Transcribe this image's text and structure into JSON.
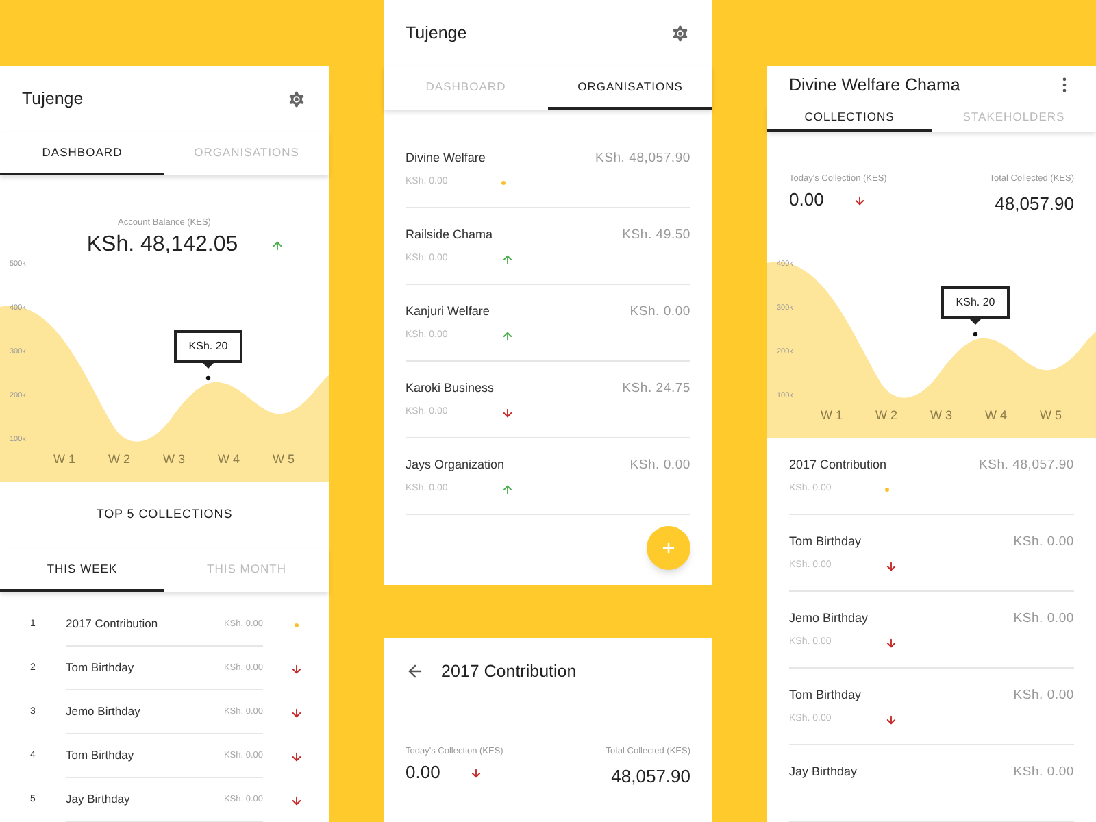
{
  "dashboard_screen": {
    "app_title": "Tujenge",
    "tabs": [
      {
        "label": "DASHBOARD",
        "selected": true
      },
      {
        "label": "ORGANISATIONS",
        "selected": false
      }
    ],
    "balance": {
      "label": "Account Balance (KES)",
      "amount": "KSh. 48,142.05",
      "kind": "up"
    },
    "chart": {
      "y_axis_labels": [
        "500k",
        "400k",
        "300k",
        "200k",
        "100k"
      ],
      "x_axis_labels": [
        "W 1",
        "W 2",
        "W 3",
        "W 4",
        "W 5"
      ],
      "tooltip": "KSh. 20"
    },
    "section_title": "TOP 5 COLLECTIONS",
    "period_tabs": [
      {
        "label": "THIS WEEK",
        "selected": true
      },
      {
        "label": "THIS MONTH",
        "selected": false
      }
    ],
    "collections": [
      {
        "rank": "1",
        "name": "2017 Contribution",
        "amount": "KSh. 0.00",
        "kind": "flat"
      },
      {
        "rank": "2",
        "name": "Tom Birthday",
        "amount": "KSh. 0.00",
        "kind": "down"
      },
      {
        "rank": "3",
        "name": "Jemo Birthday",
        "amount": "KSh. 0.00",
        "kind": "down"
      },
      {
        "rank": "4",
        "name": "Tom Birthday",
        "amount": "KSh. 0.00",
        "kind": "down"
      },
      {
        "rank": "5",
        "name": "Jay Birthday",
        "amount": "KSh. 0.00",
        "kind": "down"
      }
    ]
  },
  "organisations_screen": {
    "app_title": "Tujenge",
    "tabs": [
      {
        "label": "DASHBOARD",
        "selected": false
      },
      {
        "label": "ORGANISATIONS",
        "selected": true
      }
    ],
    "organisations": [
      {
        "name": "Divine Welfare",
        "total": "KSh. 48,057.90",
        "today": "KSh. 0.00",
        "kind": "flat"
      },
      {
        "name": "Railside Chama",
        "total": "KSh. 49.50",
        "today": "KSh. 0.00",
        "kind": "up"
      },
      {
        "name": "Kanjuri Welfare",
        "total": "KSh. 0.00",
        "today": "KSh. 0.00",
        "kind": "up"
      },
      {
        "name": "Karoki Business",
        "total": "KSh. 24.75",
        "today": "KSh. 0.00",
        "kind": "down"
      },
      {
        "name": "Jays Organization",
        "total": "KSh. 0.00",
        "today": "KSh. 0.00",
        "kind": "up"
      }
    ]
  },
  "contribution_screen": {
    "title": "2017 Contribution",
    "todays_collection": {
      "label": "Today's Collection (KES)",
      "value": "0.00",
      "kind": "down"
    },
    "total_collected": {
      "label": "Total Collected (KES)",
      "value": "48,057.90"
    }
  },
  "chama_screen": {
    "title": "Divine Welfare Chama",
    "tabs": [
      {
        "label": "COLLECTIONS",
        "selected": true
      },
      {
        "label": "STAKEHOLDERS",
        "selected": false
      }
    ],
    "todays_collection": {
      "label": "Today's Collection (KES)",
      "value": "0.00",
      "kind": "down"
    },
    "total_collected": {
      "label": "Total Collected (KES)",
      "value": "48,057.90"
    },
    "chart": {
      "y_axis_labels": [
        "400k",
        "300k",
        "200k",
        "100k"
      ],
      "x_axis_labels": [
        "W 1",
        "W 2",
        "W 3",
        "W 4",
        "W 5"
      ],
      "tooltip": "KSh. 20"
    },
    "collections": [
      {
        "name": "2017 Contribution",
        "total": "KSh. 48,057.90",
        "today": "KSh. 0.00",
        "kind": "flat"
      },
      {
        "name": "Tom Birthday",
        "total": "KSh. 0.00",
        "today": "KSh. 0.00",
        "kind": "down"
      },
      {
        "name": "Jemo Birthday",
        "total": "KSh. 0.00",
        "today": "KSh. 0.00",
        "kind": "down"
      },
      {
        "name": "Tom Birthday",
        "total": "KSh. 0.00",
        "today": "KSh. 0.00",
        "kind": "down"
      },
      {
        "name": "Jay Birthday",
        "total": "KSh. 0.00"
      }
    ]
  }
}
